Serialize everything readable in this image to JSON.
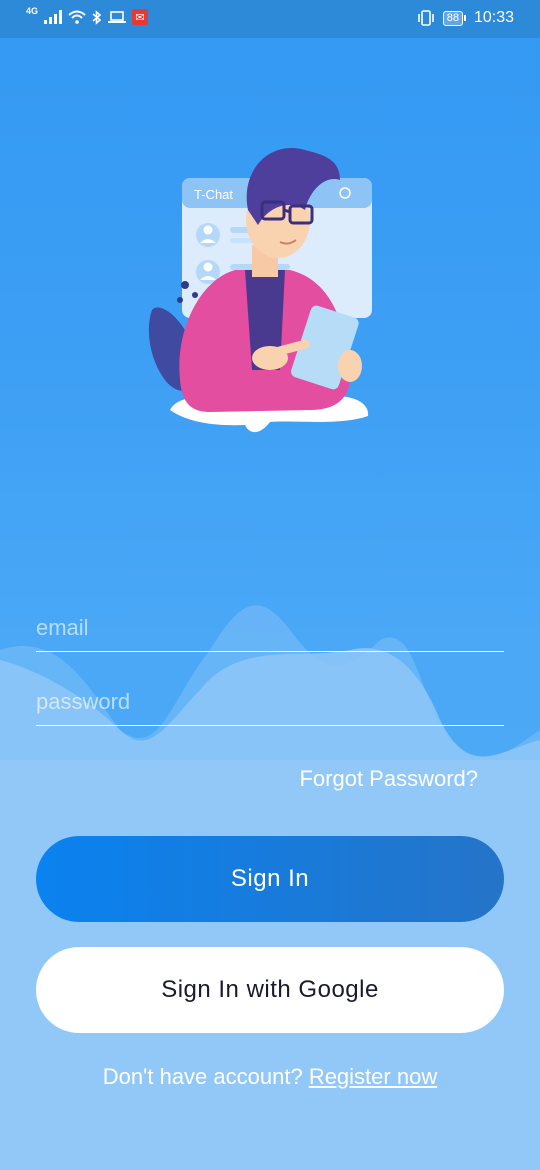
{
  "status_bar": {
    "network_label": "4G",
    "battery_level": "88",
    "time": "10:33"
  },
  "hero": {
    "app_name": "T-Chat"
  },
  "form": {
    "email_placeholder": "email",
    "password_placeholder": "password",
    "forgot_password": "Forgot Password?",
    "sign_in": "Sign In",
    "sign_in_google": "Sign In with Google",
    "no_account_text": "Don't have account?",
    "register_link": "Register now"
  },
  "colors": {
    "background": "#3399f3",
    "status_bar": "#2d8ad8",
    "sign_in_button": "#0a82f0",
    "google_button": "#ffffff"
  }
}
